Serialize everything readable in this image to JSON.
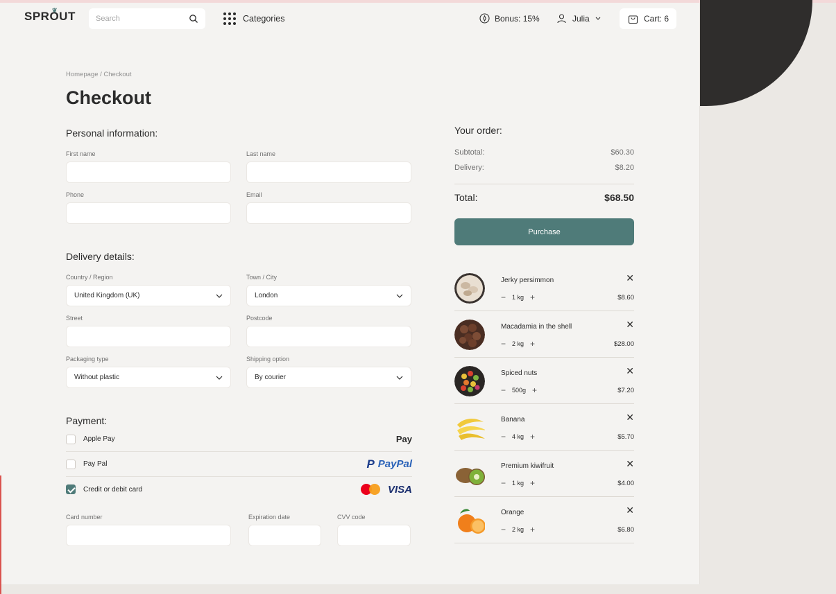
{
  "header": {
    "logo": "SPROUT",
    "search_placeholder": "Search",
    "categories": "Categories",
    "bonus": "Bonus: 15%",
    "user": "Julia",
    "cart": "Cart: 6"
  },
  "breadcrumb": "Homepage / Checkout",
  "title": "Checkout",
  "personal": {
    "heading": "Personal information:",
    "first_name": "First name",
    "last_name": "Last name",
    "phone": "Phone",
    "email": "Email"
  },
  "delivery": {
    "heading": "Delivery details:",
    "country_label": "Country / Region",
    "country_value": "United Kingdom (UK)",
    "town_label": "Town / City",
    "town_value": "London",
    "street_label": "Street",
    "postcode_label": "Postcode",
    "packaging_label": "Packaging type",
    "packaging_value": "Without plastic",
    "shipping_label": "Shipping option",
    "shipping_value": "By courier"
  },
  "payment": {
    "heading": "Payment:",
    "apple": "Apple Pay",
    "apple_logo": "Pay",
    "paypal": "Pay Pal",
    "paypal_logo": "PayPal",
    "card": "Credit or debit card",
    "visa_logo": "VISA",
    "card_number": "Card number",
    "expiration": "Expiration date",
    "cvv": "CVV code"
  },
  "order": {
    "heading": "Your order:",
    "subtotal_label": "Subtotal:",
    "subtotal_value": "$60.30",
    "delivery_label": "Delivery:",
    "delivery_value": "$8.20",
    "total_label": "Total:",
    "total_value": "$68.50",
    "purchase": "Purchase",
    "items": [
      {
        "name": "Jerky persimmon",
        "qty": "1 kg",
        "price": "$8.60"
      },
      {
        "name": "Macadamia in the shell",
        "qty": "2 kg",
        "price": "$28.00"
      },
      {
        "name": "Spiced nuts",
        "qty": "500g",
        "price": "$7.20"
      },
      {
        "name": "Banana",
        "qty": "4 kg",
        "price": "$5.70"
      },
      {
        "name": "Premium kiwifruit",
        "qty": "1 kg",
        "price": "$4.00"
      },
      {
        "name": "Orange",
        "qty": "2 kg",
        "price": "$6.80"
      }
    ]
  },
  "colors": {
    "accent": "#4f7b79",
    "background": "#f4f3f1"
  }
}
